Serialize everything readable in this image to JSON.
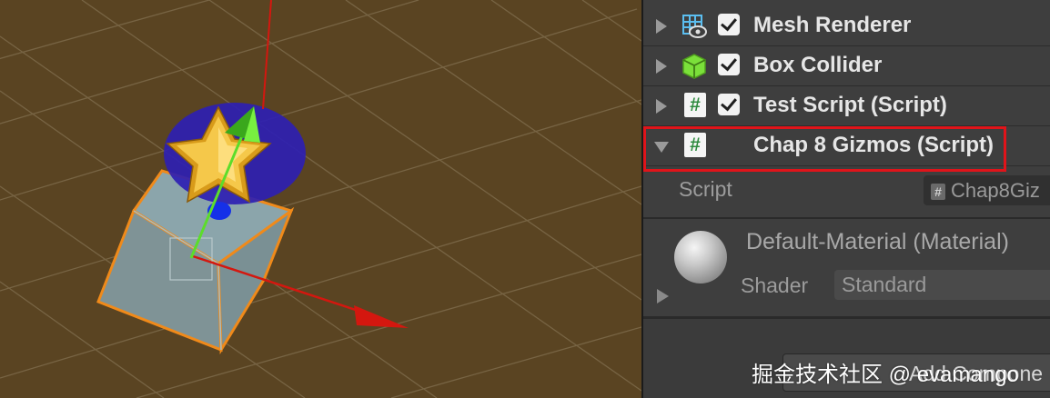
{
  "components": [
    {
      "name": "Mesh Renderer",
      "icon": "mesh-renderer-icon",
      "enabled": true
    },
    {
      "name": "Box Collider",
      "icon": "box-collider-icon",
      "enabled": true
    },
    {
      "name": "Test Script (Script)",
      "icon": "script-icon",
      "enabled": true
    },
    {
      "name": "Chap 8 Gizmos (Script)",
      "icon": "script-icon",
      "expanded": true
    }
  ],
  "script_icon_glyph": "#",
  "script_field": {
    "label": "Script",
    "value": "Chap8Giz",
    "hash": "#"
  },
  "material": {
    "name": "Default-Material (Material)",
    "shader_label": "Shader",
    "shader_value": "Standard"
  },
  "add_component_label": "Add Compone",
  "watermark": "掘金技术社区 @ evamango",
  "colors": {
    "scene_background": "#5a4422",
    "grid_line": "#7d6a4a",
    "highlight_box": "#e0141a",
    "x_axis": "#d4170f",
    "y_axis": "#5cdd2a",
    "selection_outline": "#f08a1a",
    "gizmo_sphere": "#2e1fb2",
    "script_glyph": "#2e8b3f"
  }
}
